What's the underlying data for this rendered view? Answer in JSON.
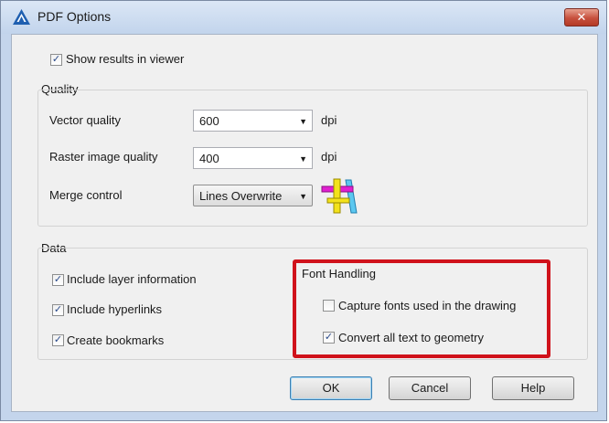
{
  "window": {
    "title": "PDF Options",
    "close_glyph": "✕"
  },
  "show_results": {
    "label": "Show results in viewer",
    "checked": true
  },
  "quality": {
    "group_title": "Quality",
    "vector_label": "Vector quality",
    "vector_value": "600",
    "vector_unit": "dpi",
    "raster_label": "Raster image quality",
    "raster_value": "400",
    "raster_unit": "dpi",
    "merge_label": "Merge control",
    "merge_value": "Lines Overwrite",
    "merge_icon": "lines-overwrite-icon"
  },
  "data": {
    "group_title": "Data",
    "include_layer": {
      "label": "Include layer information",
      "checked": true
    },
    "include_hyperlinks": {
      "label": "Include hyperlinks",
      "checked": true
    },
    "create_bookmarks": {
      "label": "Create bookmarks",
      "checked": true
    }
  },
  "font_handling": {
    "title": "Font Handling",
    "capture_fonts": {
      "label": "Capture fonts used in the drawing",
      "checked": false
    },
    "convert_text": {
      "label": "Convert all text to geometry",
      "checked": true
    },
    "highlight_color": "#d0121b"
  },
  "buttons": {
    "ok": "OK",
    "cancel": "Cancel",
    "help": "Help"
  },
  "check_glyph": "✓",
  "dropdown_glyph": "▼"
}
